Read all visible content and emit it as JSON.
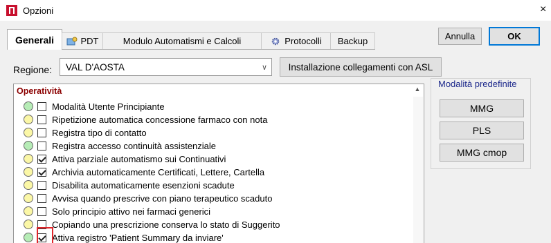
{
  "window": {
    "title": "Opzioni",
    "close_glyph": "×"
  },
  "tabs": [
    {
      "label": "Generali",
      "icon": ""
    },
    {
      "label": "PDT",
      "icon": "pdt-icon"
    },
    {
      "label": "Modulo Automatismi e Calcoli",
      "icon": ""
    },
    {
      "label": "Protocolli",
      "icon": "gear-icon"
    },
    {
      "label": "Backup",
      "icon": ""
    }
  ],
  "buttons": {
    "cancel": "Annulla",
    "ok": "OK",
    "asl": "Installazione collegamenti con ASL"
  },
  "regione": {
    "label": "Regione:",
    "value": "VAL D'AOSTA"
  },
  "section": {
    "title": "Operatività"
  },
  "options": [
    {
      "label": "Modalità Utente Principiante",
      "status": "green",
      "checked": false
    },
    {
      "label": "Ripetizione automatica concessione farmaco con nota",
      "status": "yellow",
      "checked": false
    },
    {
      "label": "Registra tipo di contatto",
      "status": "yellow",
      "checked": false
    },
    {
      "label": "Registra accesso continuità assistenziale",
      "status": "green",
      "checked": false
    },
    {
      "label": "Attiva parziale automatismo sui Continuativi",
      "status": "yellow",
      "checked": true
    },
    {
      "label": "Archivia automaticamente Certificati, Lettere, Cartella",
      "status": "yellow",
      "checked": true
    },
    {
      "label": "Disabilita automaticamente esenzioni scadute",
      "status": "yellow",
      "checked": false
    },
    {
      "label": "Avvisa quando prescrive con piano terapeutico scaduto",
      "status": "yellow",
      "checked": false
    },
    {
      "label": "Solo principio attivo nei farmaci generici",
      "status": "yellow",
      "checked": false
    },
    {
      "label": "Copiando una prescrizione conserva lo stato di Suggerito",
      "status": "yellow",
      "checked": false
    },
    {
      "label": "Attiva registro 'Patient Summary da inviare'",
      "status": "green",
      "checked": true
    }
  ],
  "presets": {
    "title": "Modalità predefinite",
    "items": [
      {
        "label": "MMG"
      },
      {
        "label": "PLS"
      },
      {
        "label": "MMG cmop"
      }
    ]
  },
  "colors": {
    "section_title": "#8b0000",
    "preset_title": "#1e2a8c",
    "highlight": "#e0262b",
    "ok_border": "#0078d7"
  }
}
